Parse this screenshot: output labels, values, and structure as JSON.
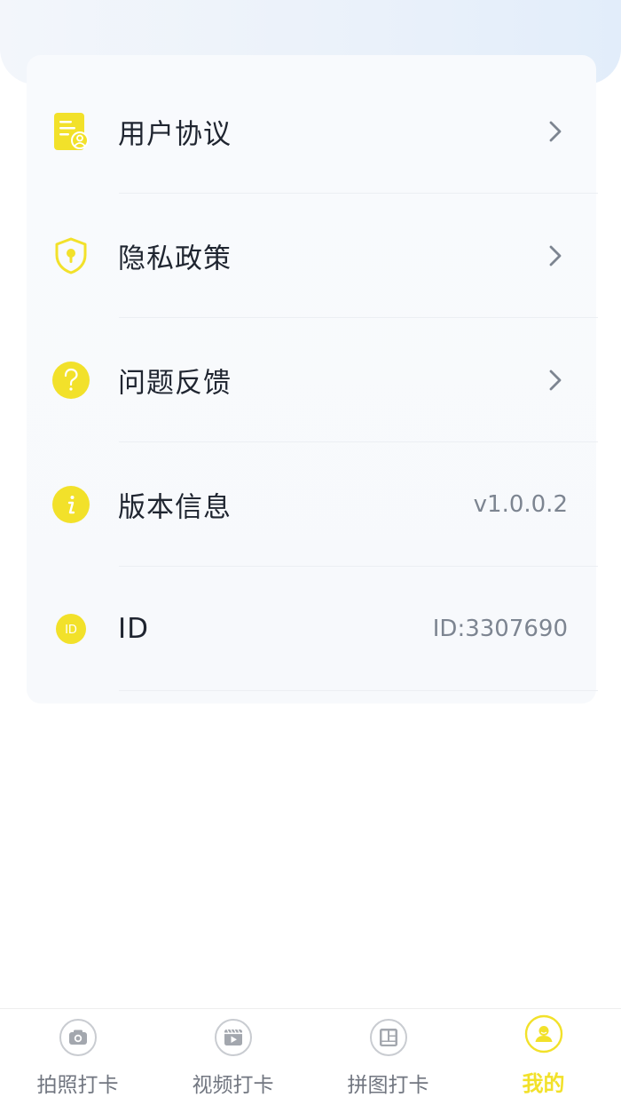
{
  "menu": {
    "items": [
      {
        "label": "用户协议",
        "icon": "document-user-icon"
      },
      {
        "label": "隐私政策",
        "icon": "shield-lock-icon"
      },
      {
        "label": "问题反馈",
        "icon": "question-icon"
      },
      {
        "label": "版本信息",
        "icon": "info-icon",
        "value": "v1.0.0.2"
      },
      {
        "label": "ID",
        "icon": "id-icon",
        "value": "ID:3307690"
      }
    ]
  },
  "tabbar": {
    "tabs": [
      {
        "label": "拍照打卡",
        "icon": "camera-icon"
      },
      {
        "label": "视频打卡",
        "icon": "video-icon"
      },
      {
        "label": "拼图打卡",
        "icon": "collage-icon"
      },
      {
        "label": "我的",
        "icon": "profile-icon",
        "active": true
      }
    ]
  },
  "colors": {
    "accent": "#f2e12a",
    "text": "#1f2530",
    "muted": "#7d8591",
    "tab_inactive": "#717680"
  }
}
